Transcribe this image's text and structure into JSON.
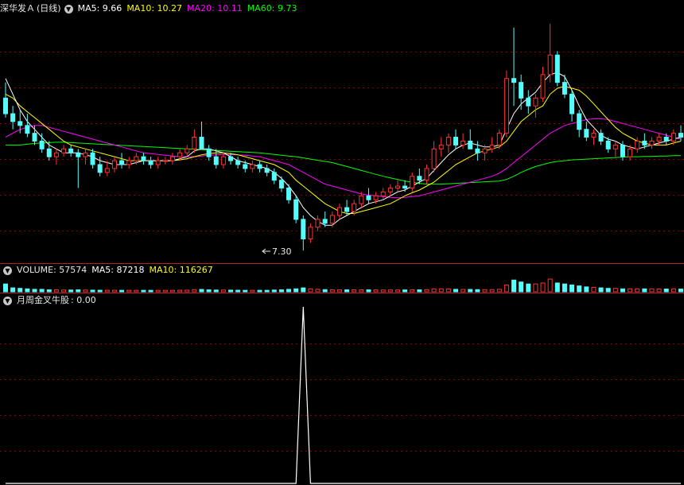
{
  "main_header": {
    "stock_name": "深华发Ａ",
    "period": "(日线)",
    "ma_labels": [
      {
        "text": "MA5: 9.66",
        "color": "#ffffff"
      },
      {
        "text": "MA10: 10.27",
        "color": "#ffff00"
      },
      {
        "text": "MA20: 10.11",
        "color": "#ff00ff"
      },
      {
        "text": "MA60: 9.73",
        "color": "#00ff00"
      }
    ]
  },
  "volume_header": {
    "title": "VOLUME: 57574",
    "ma_labels": [
      {
        "text": "MA5: 87218",
        "color": "#ffffff"
      },
      {
        "text": "MA10: 116267",
        "color": "#ffff00"
      }
    ]
  },
  "indicator_header": {
    "title": "月周金叉牛股",
    "value": ": 0.00"
  },
  "low_annotation": "7.30",
  "colors": {
    "up": "#ff3232",
    "down": "#54fcfc",
    "grid": "#8b0000",
    "ma5": "#ffffff",
    "ma10": "#ffff00",
    "ma20": "#ff00ff",
    "ma60": "#00ff00",
    "indicator": "#ffffff"
  },
  "chart_data": {
    "type": "candlestick",
    "price_range": [
      7.0,
      13.3
    ],
    "candles": [
      [
        11.2,
        11.6,
        10.7,
        10.8
      ],
      [
        10.8,
        11.0,
        10.4,
        10.6
      ],
      [
        10.6,
        10.9,
        10.3,
        10.5
      ],
      [
        10.5,
        10.8,
        10.2,
        10.3
      ],
      [
        10.3,
        10.5,
        10.0,
        10.1
      ],
      [
        10.1,
        10.3,
        9.8,
        9.9
      ],
      [
        9.9,
        10.1,
        9.6,
        9.7
      ],
      [
        9.7,
        9.9,
        9.5,
        9.8
      ],
      [
        9.8,
        10.0,
        9.7,
        9.9
      ],
      [
        9.9,
        10.0,
        9.7,
        9.8
      ],
      [
        9.8,
        9.9,
        8.9,
        9.7
      ],
      [
        9.7,
        9.9,
        9.5,
        9.8
      ],
      [
        9.8,
        9.9,
        9.4,
        9.5
      ],
      [
        9.5,
        9.7,
        9.2,
        9.3
      ],
      [
        9.3,
        9.6,
        9.2,
        9.4
      ],
      [
        9.4,
        9.7,
        9.3,
        9.6
      ],
      [
        9.6,
        9.8,
        9.4,
        9.5
      ],
      [
        9.5,
        9.7,
        9.4,
        9.6
      ],
      [
        9.6,
        9.8,
        9.5,
        9.7
      ],
      [
        9.7,
        9.8,
        9.5,
        9.6
      ],
      [
        9.6,
        9.7,
        9.4,
        9.5
      ],
      [
        9.5,
        9.7,
        9.4,
        9.6
      ],
      [
        9.6,
        9.7,
        9.5,
        9.6
      ],
      [
        9.6,
        9.8,
        9.5,
        9.7
      ],
      [
        9.7,
        9.9,
        9.6,
        9.8
      ],
      [
        9.8,
        10.0,
        9.7,
        9.9
      ],
      [
        9.9,
        10.4,
        9.8,
        10.2
      ],
      [
        10.2,
        10.6,
        10.0,
        9.9
      ],
      [
        9.9,
        10.0,
        9.6,
        9.7
      ],
      [
        9.7,
        9.9,
        9.4,
        9.5
      ],
      [
        9.5,
        9.8,
        9.4,
        9.7
      ],
      [
        9.7,
        9.8,
        9.5,
        9.6
      ],
      [
        9.6,
        9.7,
        9.4,
        9.5
      ],
      [
        9.5,
        9.6,
        9.3,
        9.4
      ],
      [
        9.4,
        9.6,
        9.3,
        9.5
      ],
      [
        9.5,
        9.6,
        9.3,
        9.4
      ],
      [
        9.4,
        9.5,
        9.2,
        9.3
      ],
      [
        9.3,
        9.4,
        9.0,
        9.1
      ],
      [
        9.1,
        9.2,
        8.8,
        8.9
      ],
      [
        8.9,
        9.0,
        8.5,
        8.6
      ],
      [
        8.6,
        8.7,
        8.0,
        8.1
      ],
      [
        8.1,
        8.2,
        7.3,
        7.6
      ],
      [
        7.6,
        8.0,
        7.5,
        7.9
      ],
      [
        7.9,
        8.2,
        7.8,
        8.1
      ],
      [
        8.1,
        8.3,
        7.9,
        8.0
      ],
      [
        8.0,
        8.3,
        7.9,
        8.2
      ],
      [
        8.2,
        8.5,
        8.1,
        8.4
      ],
      [
        8.4,
        8.6,
        8.2,
        8.3
      ],
      [
        8.3,
        8.6,
        8.2,
        8.5
      ],
      [
        8.5,
        8.8,
        8.4,
        8.7
      ],
      [
        8.7,
        8.9,
        8.5,
        8.6
      ],
      [
        8.6,
        8.8,
        8.5,
        8.7
      ],
      [
        8.7,
        8.9,
        8.6,
        8.8
      ],
      [
        8.8,
        9.0,
        8.7,
        8.9
      ],
      [
        8.9,
        9.1,
        8.8,
        8.95
      ],
      [
        8.95,
        9.1,
        8.8,
        8.9
      ],
      [
        8.9,
        9.3,
        8.8,
        9.2
      ],
      [
        9.2,
        9.4,
        9.0,
        9.1
      ],
      [
        9.1,
        9.5,
        9.0,
        9.4
      ],
      [
        9.4,
        10.1,
        9.3,
        9.9
      ],
      [
        9.9,
        10.2,
        9.7,
        10.0
      ],
      [
        10.0,
        10.3,
        9.8,
        10.2
      ],
      [
        10.2,
        10.4,
        9.9,
        10.0
      ],
      [
        10.0,
        10.3,
        9.9,
        10.1
      ],
      [
        10.1,
        10.4,
        9.9,
        9.9
      ],
      [
        9.9,
        10.1,
        9.6,
        9.8
      ],
      [
        9.8,
        10.0,
        9.6,
        9.9
      ],
      [
        9.9,
        10.2,
        9.8,
        10.0
      ],
      [
        10.0,
        10.4,
        9.9,
        10.3
      ],
      [
        10.3,
        11.9,
        10.2,
        11.7
      ],
      [
        11.7,
        13.0,
        11.0,
        11.6
      ],
      [
        11.6,
        11.8,
        10.9,
        11.2
      ],
      [
        11.2,
        11.4,
        10.8,
        11.0
      ],
      [
        11.0,
        11.3,
        10.7,
        11.2
      ],
      [
        11.2,
        12.0,
        11.1,
        11.8
      ],
      [
        11.8,
        13.1,
        11.6,
        12.3
      ],
      [
        12.3,
        12.4,
        11.5,
        11.6
      ],
      [
        11.6,
        11.8,
        11.2,
        11.3
      ],
      [
        11.3,
        11.4,
        10.6,
        10.8
      ],
      [
        10.8,
        10.9,
        10.2,
        10.4
      ],
      [
        10.4,
        10.6,
        10.1,
        10.2
      ],
      [
        10.2,
        10.4,
        10.0,
        10.3
      ],
      [
        10.3,
        10.4,
        10.0,
        10.1
      ],
      [
        10.1,
        10.2,
        9.8,
        9.9
      ],
      [
        9.9,
        10.1,
        9.7,
        10.0
      ],
      [
        10.0,
        10.1,
        9.6,
        9.7
      ],
      [
        9.7,
        10.0,
        9.6,
        9.9
      ],
      [
        9.9,
        10.2,
        9.8,
        10.1
      ],
      [
        10.1,
        10.3,
        9.9,
        10.0
      ],
      [
        10.0,
        10.2,
        9.9,
        10.1
      ],
      [
        10.1,
        10.3,
        10.0,
        10.2
      ],
      [
        10.2,
        10.3,
        10.0,
        10.1
      ],
      [
        10.1,
        10.4,
        10.0,
        10.3
      ],
      [
        10.3,
        10.5,
        10.1,
        10.2
      ]
    ],
    "ma5": [
      11.7,
      11.3,
      10.9,
      10.6,
      10.4,
      10.2,
      10.0,
      9.9,
      9.8,
      9.8,
      9.8,
      9.75,
      9.7,
      9.6,
      9.55,
      9.5,
      9.5,
      9.5,
      9.55,
      9.6,
      9.6,
      9.6,
      9.6,
      9.6,
      9.65,
      9.7,
      9.85,
      9.9,
      9.9,
      9.85,
      9.8,
      9.7,
      9.6,
      9.55,
      9.5,
      9.45,
      9.4,
      9.3,
      9.15,
      8.95,
      8.7,
      8.4,
      8.2,
      8.05,
      7.95,
      7.95,
      8.1,
      8.2,
      8.3,
      8.4,
      8.5,
      8.55,
      8.6,
      8.7,
      8.8,
      8.85,
      8.95,
      9.05,
      9.15,
      9.35,
      9.55,
      9.75,
      9.9,
      10.0,
      10.05,
      10.0,
      9.95,
      9.95,
      10.0,
      10.4,
      10.8,
      11.05,
      11.2,
      11.35,
      11.6,
      11.8,
      11.85,
      11.75,
      11.4,
      11.0,
      10.65,
      10.45,
      10.25,
      10.15,
      10.1,
      10.0,
      9.95,
      9.9,
      9.95,
      10.0,
      10.05,
      10.1,
      10.15,
      10.2
    ],
    "ma10": [
      11.3,
      11.2,
      11.0,
      10.85,
      10.7,
      10.55,
      10.4,
      10.25,
      10.1,
      10.0,
      9.95,
      9.9,
      9.85,
      9.8,
      9.75,
      9.7,
      9.65,
      9.6,
      9.6,
      9.6,
      9.6,
      9.6,
      9.6,
      9.6,
      9.62,
      9.65,
      9.7,
      9.75,
      9.78,
      9.8,
      9.8,
      9.78,
      9.75,
      9.7,
      9.65,
      9.6,
      9.55,
      9.5,
      9.4,
      9.3,
      9.1,
      8.95,
      8.8,
      8.65,
      8.5,
      8.4,
      8.3,
      8.25,
      8.25,
      8.3,
      8.35,
      8.4,
      8.45,
      8.5,
      8.6,
      8.7,
      8.78,
      8.85,
      8.95,
      9.05,
      9.2,
      9.35,
      9.5,
      9.6,
      9.7,
      9.8,
      9.85,
      9.9,
      9.95,
      10.1,
      10.35,
      10.6,
      10.75,
      10.9,
      11.0,
      11.3,
      11.45,
      11.5,
      11.45,
      11.4,
      11.25,
      11.05,
      10.85,
      10.65,
      10.45,
      10.3,
      10.2,
      10.1,
      10.05,
      10.0,
      10.0,
      10.0,
      10.05,
      10.1
    ],
    "ma20": [
      10.2,
      10.3,
      10.4,
      10.45,
      10.5,
      10.5,
      10.45,
      10.4,
      10.35,
      10.3,
      10.25,
      10.2,
      10.15,
      10.1,
      10.05,
      10.0,
      9.95,
      9.9,
      9.85,
      9.8,
      9.78,
      9.76,
      9.74,
      9.72,
      9.71,
      9.7,
      9.7,
      9.72,
      9.74,
      9.75,
      9.76,
      9.76,
      9.75,
      9.74,
      9.72,
      9.7,
      9.65,
      9.6,
      9.55,
      9.5,
      9.4,
      9.3,
      9.2,
      9.1,
      9.0,
      8.95,
      8.9,
      8.85,
      8.8,
      8.75,
      8.72,
      8.7,
      8.68,
      8.66,
      8.65,
      8.66,
      8.68,
      8.7,
      8.75,
      8.8,
      8.85,
      8.9,
      8.95,
      9.0,
      9.05,
      9.1,
      9.15,
      9.2,
      9.28,
      9.4,
      9.55,
      9.7,
      9.85,
      10.0,
      10.15,
      10.3,
      10.4,
      10.5,
      10.55,
      10.6,
      10.65,
      10.67,
      10.67,
      10.65,
      10.6,
      10.55,
      10.5,
      10.45,
      10.4,
      10.35,
      10.3,
      10.25,
      10.2,
      10.15
    ],
    "ma60": [
      10.0,
      10.0,
      10.0,
      10.02,
      10.04,
      10.05,
      10.06,
      10.07,
      10.07,
      10.06,
      10.05,
      10.04,
      10.03,
      10.02,
      10.01,
      10.0,
      9.99,
      9.98,
      9.97,
      9.96,
      9.95,
      9.94,
      9.93,
      9.92,
      9.91,
      9.9,
      9.89,
      9.88,
      9.87,
      9.86,
      9.85,
      9.84,
      9.83,
      9.82,
      9.81,
      9.8,
      9.78,
      9.76,
      9.74,
      9.72,
      9.7,
      9.67,
      9.64,
      9.61,
      9.58,
      9.55,
      9.5,
      9.45,
      9.4,
      9.35,
      9.3,
      9.25,
      9.2,
      9.16,
      9.12,
      9.08,
      9.05,
      9.02,
      9.0,
      9.0,
      9.0,
      9.01,
      9.02,
      9.03,
      9.04,
      9.05,
      9.06,
      9.07,
      9.08,
      9.12,
      9.2,
      9.3,
      9.38,
      9.45,
      9.5,
      9.55,
      9.58,
      9.6,
      9.62,
      9.63,
      9.64,
      9.65,
      9.66,
      9.67,
      9.68,
      9.69,
      9.7,
      9.7,
      9.71,
      9.71,
      9.72,
      9.72,
      9.73,
      9.73
    ],
    "volume": [
      8000,
      4000,
      3500,
      3000,
      2500,
      2500,
      2000,
      2000,
      1800,
      1800,
      2000,
      1800,
      1700,
      1600,
      1600,
      1600,
      1500,
      1500,
      1500,
      1500,
      1500,
      1500,
      1500,
      1500,
      1600,
      1700,
      2200,
      2400,
      2000,
      1800,
      1800,
      1700,
      1600,
      1500,
      1500,
      1500,
      1500,
      1800,
      2000,
      2500,
      3000,
      4000,
      3000,
      2500,
      2200,
      2000,
      2000,
      2000,
      2000,
      2000,
      2000,
      1900,
      1900,
      1900,
      1900,
      1900,
      2000,
      2000,
      2200,
      3000,
      3000,
      2800,
      2500,
      2400,
      2400,
      2200,
      2200,
      2200,
      2500,
      7000,
      12000,
      10000,
      8000,
      8000,
      9000,
      13000,
      9000,
      8000,
      7000,
      6000,
      5000,
      4500,
      4000,
      3500,
      3500,
      3000,
      3000,
      3000,
      3000,
      3000,
      2800,
      2800,
      3000,
      2800
    ],
    "indicator_peak_index": 41,
    "indicator_peak_value": 1
  }
}
